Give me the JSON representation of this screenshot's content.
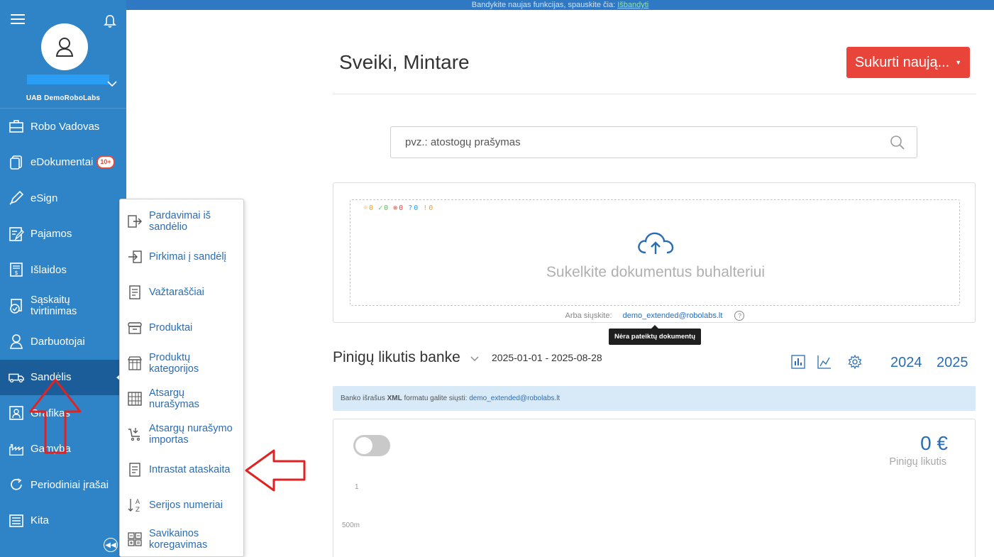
{
  "top_notice": {
    "text": "Bandykite naujas funkcijas, spauskite čia:",
    "link": "Išbandyti"
  },
  "sidebar": {
    "company": "UAB DemoRoboLabs",
    "items": [
      {
        "label": "Robo Vadovas",
        "icon": "briefcase-icon"
      },
      {
        "label": "eDokumentai",
        "icon": "documents-icon",
        "badge": "10+"
      },
      {
        "label": "eSign",
        "icon": "pen-icon"
      },
      {
        "label": "Pajamos",
        "icon": "invoice-edit-icon"
      },
      {
        "label": "Išlaidos",
        "icon": "receipt-icon"
      },
      {
        "label": "Sąskaitų tvirtinimas",
        "icon": "approve-icon"
      },
      {
        "label": "Darbuotojai",
        "icon": "employee-icon"
      },
      {
        "label": "Sandėlis",
        "icon": "truck-icon"
      },
      {
        "label": "Grafikas",
        "icon": "schedule-icon"
      },
      {
        "label": "Gamyba",
        "icon": "factory-icon"
      },
      {
        "label": "Periodiniai įrašai",
        "icon": "refresh-icon"
      },
      {
        "label": "Kita",
        "icon": "list-icon"
      }
    ],
    "active_index": 7
  },
  "submenu": {
    "items": [
      {
        "label": "Pardavimai iš sandėlio",
        "icon": "export-icon"
      },
      {
        "label": "Pirkimai į sandėlį",
        "icon": "import-icon"
      },
      {
        "label": "Važtaraščiai",
        "icon": "waybill-icon"
      },
      {
        "label": "Produktai",
        "icon": "archive-icon"
      },
      {
        "label": "Produktų kategorijos",
        "icon": "store-icon"
      },
      {
        "label": "Atsargų nurašymas",
        "icon": "stock-writeoff-icon"
      },
      {
        "label": "Atsargų nurašymo importas",
        "icon": "cart-import-icon"
      },
      {
        "label": "Intrastat ataskaita",
        "icon": "report-icon"
      },
      {
        "label": "Serijos numeriai",
        "icon": "sort-az-icon"
      },
      {
        "label": "Savikainos koregavimas",
        "icon": "calculator-icon"
      }
    ]
  },
  "header": {
    "greeting": "Sveiki, Mintare",
    "create_button": "Sukurti naują..."
  },
  "search": {
    "placeholder": "pvz.: atostogų prašymas"
  },
  "upload": {
    "counters": [
      "0",
      "0",
      "0",
      "0",
      "0"
    ],
    "counter_colors": [
      "#f0a030",
      "#5cb85c",
      "#e14b3b",
      "#2a9df4",
      "#f0a030"
    ],
    "title": "Sukelkite dokumentus buhalteriui",
    "mail_prefix": "Arba siųskite:",
    "mail": "demo_extended@robolabs.lt",
    "tooltip": "Nėra pateiktų dokumentų"
  },
  "balance": {
    "title": "Pinigų likutis banke",
    "range": "2025-01-01 - 2025-08-28",
    "years": [
      "2024",
      "2025"
    ],
    "info_pre": "Banko išrašus ",
    "info_bold": "XML",
    "info_mid": " formatu galite siųsti: ",
    "info_mail": "demo_extended@robolabs.lt",
    "amount": "0 €",
    "amount_label": "Pinigų likutis",
    "y_ticks": [
      "1",
      "500m"
    ]
  },
  "colors": {
    "sidebar": "#2f84c8",
    "sidebar_active": "#1b5d99",
    "accent_red": "#e8443a",
    "link_blue": "#2a6db5"
  }
}
